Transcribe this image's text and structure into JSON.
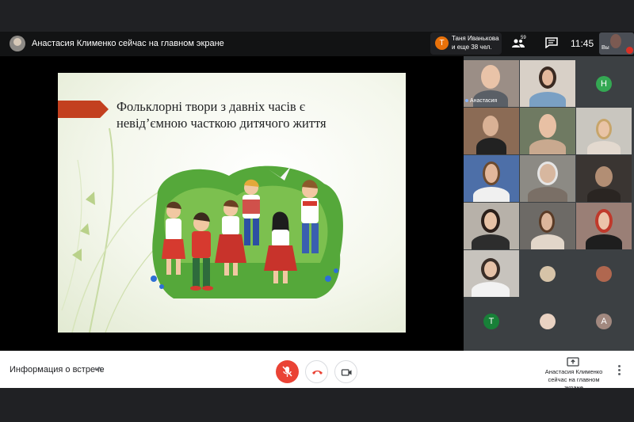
{
  "header": {
    "presenter_banner": "Анастасия Клименко сейчас на главном экране",
    "notification": {
      "initial": "T",
      "name": "Таня Иванькова",
      "others": "и еще 38 чел."
    },
    "people_count": "59",
    "time": "11:45",
    "self_label": "Вы"
  },
  "slide": {
    "title": "Фольклорні твори з давніх часів є невід’ємною часткою дитячого життя"
  },
  "grid": {
    "tiles": [
      {
        "label": "Анастасия"
      },
      {
        "initial": "Н",
        "color": "#34a853"
      },
      {
        "initial": "T",
        "color": "#188038"
      },
      {
        "initial": "A",
        "color": "#a1887f"
      }
    ]
  },
  "footer": {
    "meeting_info": "Информация о встрече",
    "presenting_label": "Анастасия Клименко сейчас на главном экране"
  },
  "colors": {
    "accent_red": "#ea4335",
    "slide_arrow": "#c3401f"
  }
}
